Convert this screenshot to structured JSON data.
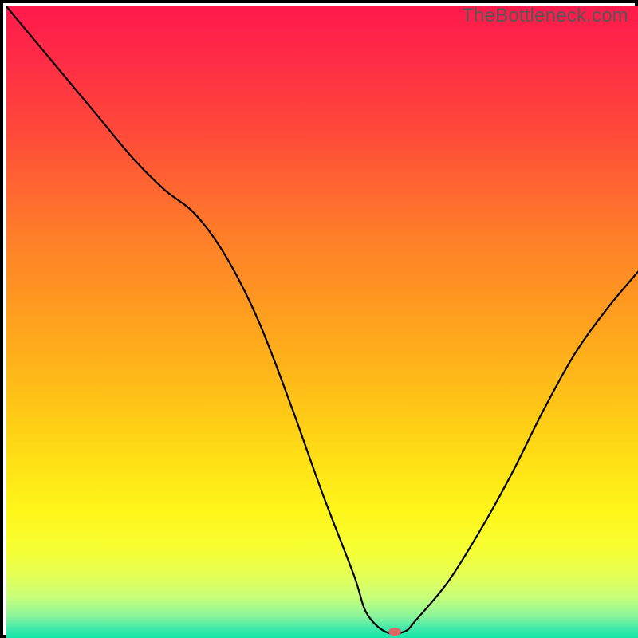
{
  "watermark": "TheBottleneck.com",
  "chart_data": {
    "type": "line",
    "title": "",
    "xlabel": "",
    "ylabel": "",
    "xlim": [
      0,
      100
    ],
    "ylim": [
      0,
      100
    ],
    "x": [
      0,
      5,
      10,
      15,
      20,
      25,
      30,
      35,
      40,
      45,
      50,
      55,
      57,
      60,
      63,
      65,
      70,
      75,
      80,
      85,
      90,
      95,
      100
    ],
    "y": [
      100,
      94,
      88,
      82,
      76,
      71,
      67,
      60,
      50,
      37,
      23,
      10,
      4,
      1,
      1,
      3,
      9,
      17,
      26,
      36,
      45,
      52,
      58
    ],
    "marker": {
      "x": 61.5,
      "y": 1.0,
      "color": "#e06666",
      "rx": 8,
      "ry": 5
    },
    "gradient_stops": [
      {
        "offset": 0.0,
        "color": "#ff1a4c"
      },
      {
        "offset": 0.08,
        "color": "#ff2a46"
      },
      {
        "offset": 0.2,
        "color": "#ff4a3a"
      },
      {
        "offset": 0.35,
        "color": "#ff7a2a"
      },
      {
        "offset": 0.5,
        "color": "#ffa11e"
      },
      {
        "offset": 0.62,
        "color": "#ffc217"
      },
      {
        "offset": 0.72,
        "color": "#ffe015"
      },
      {
        "offset": 0.8,
        "color": "#fff61a"
      },
      {
        "offset": 0.86,
        "color": "#f6ff33"
      },
      {
        "offset": 0.9,
        "color": "#e5ff55"
      },
      {
        "offset": 0.935,
        "color": "#c8ff7a"
      },
      {
        "offset": 0.965,
        "color": "#8cf59a"
      },
      {
        "offset": 0.985,
        "color": "#40e9ab"
      },
      {
        "offset": 1.0,
        "color": "#13e6a7"
      }
    ]
  }
}
